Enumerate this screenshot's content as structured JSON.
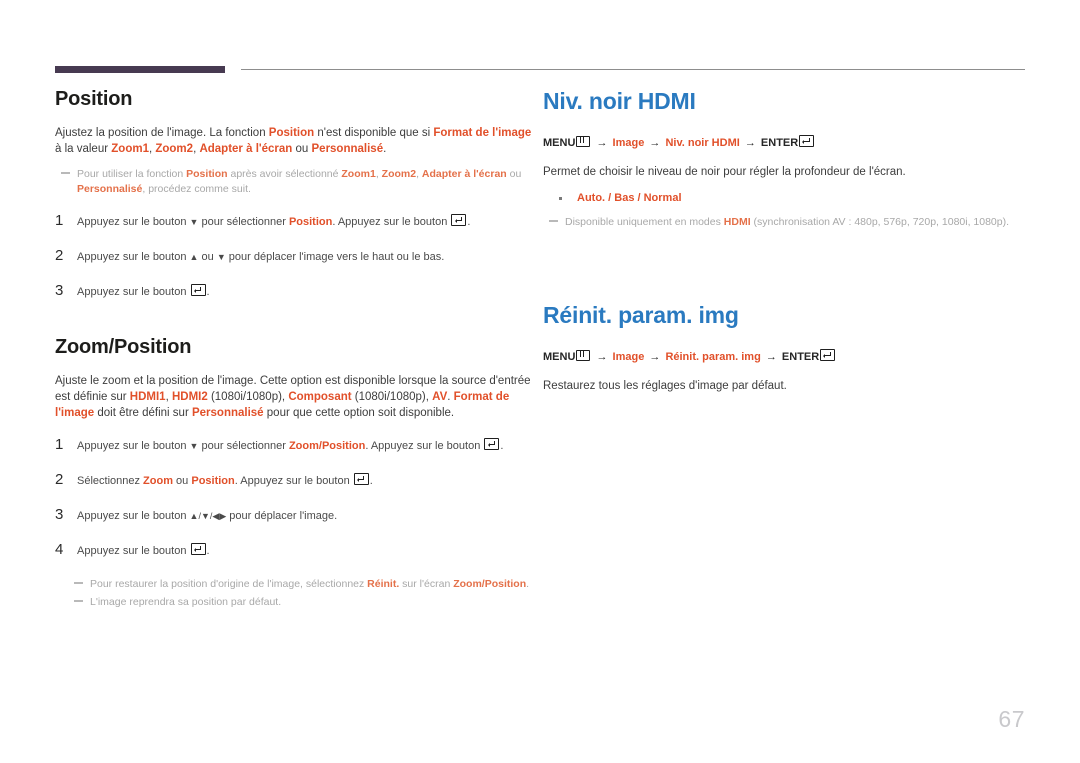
{
  "page": {
    "number": "67"
  },
  "left_column": {
    "blocks": [
      {
        "heading": "Position",
        "intro_1": "Ajustez la position de l'image. La fonction ",
        "intro_hl_1": "Position",
        "intro_2": " n'est disponible que si ",
        "intro_hl_2": "Format de l'image",
        "intro_3": " à la valeur ",
        "intro_hl_3": "Zoom1",
        "intro_4": ", ",
        "intro_hl_4": "Zoom2",
        "intro_5": ", ",
        "intro_hl_5": "Adapter à l'écran",
        "intro_6": " ou ",
        "intro_hl_6": "Personnalisé",
        "intro_7": ".",
        "note": {
          "t1": "Pour utiliser la fonction ",
          "h1": "Position",
          "t2": " après avoir sélectionné ",
          "h2": "Zoom1",
          "t3": ", ",
          "h3": "Zoom2",
          "t4": ", ",
          "h4": "Adapter à l'écran",
          "t5": " ou ",
          "h5": "Personnalisé",
          "t6": ", procédez comme suit."
        },
        "steps": [
          {
            "num": "1",
            "p1": "Appuyez sur le bouton ",
            "icon1": "arrow-down-icon",
            "p2": " pour sélectionner ",
            "hl": "Position",
            "p3": ". Appuyez sur le bouton ",
            "icon2": "enter-icon",
            "p4": "."
          },
          {
            "num": "2",
            "p1": "Appuyez sur le bouton ",
            "icon1": "arrow-up-icon",
            "p2": " ou ",
            "icon2": "arrow-down-icon",
            "p3": " pour déplacer l'image vers le haut ou le bas.",
            "hl": "",
            "p4": ""
          },
          {
            "num": "3",
            "p1": "Appuyez sur le bouton ",
            "icon1": "enter-icon",
            "p2": ".",
            "hl": "",
            "p3": "",
            "p4": ""
          }
        ]
      },
      {
        "heading": "Zoom/Position",
        "intro_1": "Ajuste le zoom et la position de l'image. Cette option est disponible lorsque la source d'entrée est définie sur ",
        "intro_hl_1": "HDMI1",
        "intro_2": ", ",
        "intro_hl_2": "HDMI2",
        "intro_3": " (1080i/1080p), ",
        "intro_hl_3": "Composant",
        "intro_4": " (1080i/1080p), ",
        "intro_hl_4": "AV",
        "intro_5": ". ",
        "intro_hl_5": "Format de l'image",
        "intro_6": " doit être défini sur ",
        "intro_hl_6": "Personnalisé",
        "intro_7": " pour que cette option soit disponible.",
        "steps": [
          {
            "num": "1",
            "p1": "Appuyez sur le bouton ",
            "icon1": "arrow-down-icon",
            "p2": " pour sélectionner ",
            "hl": "Zoom/Position",
            "p3": ". Appuyez sur le bouton ",
            "icon2": "enter-icon",
            "p4": "."
          },
          {
            "num": "2",
            "p1": "Sélectionnez ",
            "hl": "Zoom",
            "p2": " ou ",
            "hl2": "Position",
            "p3": ". Appuyez sur le bouton ",
            "icon2": "enter-icon",
            "p4": "."
          },
          {
            "num": "3",
            "p1": "Appuyez sur le bouton ",
            "icons": "arrow-up-down-left-right-icons",
            "p2": " pour déplacer l'image.",
            "p3": "",
            "p4": ""
          },
          {
            "num": "4",
            "p1": "Appuyez sur le bouton ",
            "icon1": "enter-icon",
            "p2": ".",
            "p3": "",
            "p4": ""
          }
        ],
        "notes": [
          {
            "t1": "Pour restaurer la position d'origine de l'image, sélectionnez ",
            "h1": "Réinit.",
            "t2": " sur l'écran ",
            "h2": "Zoom/Position",
            "t3": "."
          },
          {
            "t1": "L'image reprendra sa position par défaut.",
            "h1": "",
            "t2": "",
            "h2": "",
            "t3": ""
          }
        ]
      }
    ]
  },
  "right_column": {
    "blocks": [
      {
        "heading": "Niv. noir HDMI",
        "menu_path": {
          "menu_label": "MENU",
          "menu_icon": "menu-icon",
          "arrow1": "→",
          "item1": "Image",
          "arrow2": "→",
          "item2": "Niv. noir HDMI",
          "arrow3": "→",
          "enter_label": "ENTER",
          "enter_icon": "enter-icon"
        },
        "description": "Permet de choisir le niveau de noir pour régler la profondeur de l'écran.",
        "options": [
          "Auto. / Bas / Normal"
        ],
        "note": {
          "t1": "Disponible uniquement en modes ",
          "h1": "HDMI",
          "t2": " (synchronisation AV : 480p, 576p, 720p, 1080i, 1080p)."
        }
      },
      {
        "heading": "Réinit. param. img",
        "menu_path": {
          "menu_label": "MENU",
          "menu_icon": "menu-icon",
          "arrow1": "→",
          "item1": "Image",
          "arrow2": "→",
          "item2": "Réinit. param. img",
          "arrow3": "→",
          "enter_label": "ENTER",
          "enter_icon": "enter-icon"
        },
        "description": "Restaurez tous les réglages d'image par défaut.",
        "options": [],
        "note": null
      }
    ]
  },
  "colors": {
    "accent_orange": "#e1502a",
    "heading_blue": "#2a7ac0",
    "rule_purple": "#473a51",
    "note_gray": "#a8a8a8",
    "page_number_gray": "#c9c9cc"
  }
}
